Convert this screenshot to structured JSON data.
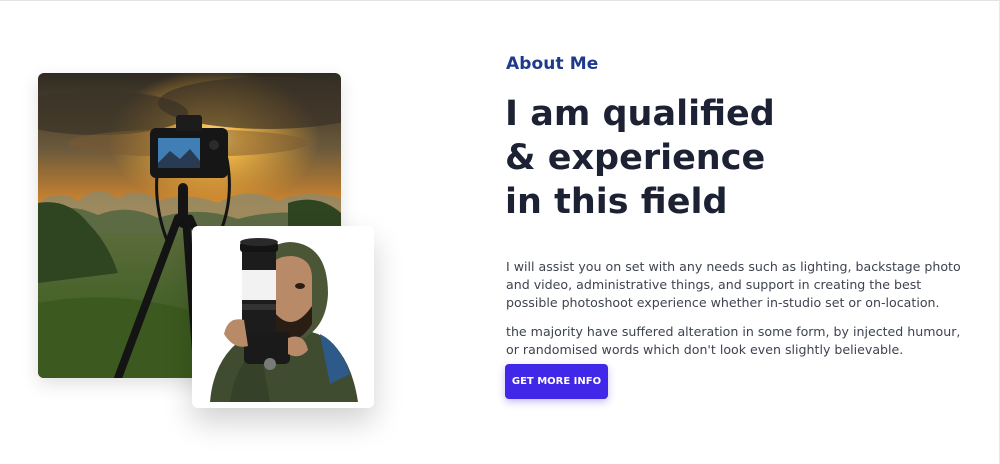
{
  "about": {
    "eyebrow": "About Me",
    "headline_lines": [
      "I am qualified",
      "& experience",
      "in this field"
    ],
    "paragraph_1": "I will assist you on set with any needs such as lighting, backstage photo and video, administrative things, and support in creating the best possible photoshoot experience whether in-studio set or on-location.",
    "paragraph_2": "the majority have suffered alteration in some form, by injected humour, or randomised words which don't look even slightly believable.",
    "cta_label": "GET MORE INFO"
  },
  "colors": {
    "eyebrow": "#1e3a8a",
    "headline": "#1c2233",
    "body_text": "#3e4350",
    "cta_background": "#4127e8"
  }
}
